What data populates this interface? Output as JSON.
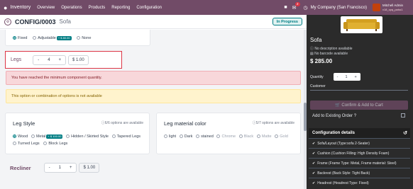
{
  "navbar": {
    "brand": "Inventory",
    "menu": [
      "Overview",
      "Operations",
      "Products",
      "Reporting",
      "Configuration"
    ],
    "notif_count": "2",
    "company": "My Company (San Francisco)",
    "user_name": "Mitchell Admin",
    "user_db": "v18_cpq_paho1"
  },
  "control": {
    "title": "CONFIG/0003",
    "subtitle": "Sofa",
    "status": "In Progress"
  },
  "top_card": {
    "options": [
      {
        "label": "Fixed",
        "selected": true
      },
      {
        "label": "Adjustable",
        "price": "+ $ 80.00"
      },
      {
        "label": "None"
      }
    ]
  },
  "legs": {
    "label": "Legs",
    "minus": "-",
    "value": "4",
    "plus": "+",
    "price": "$ 1.00"
  },
  "alerts": {
    "danger": "You have reached the minimum component quantity.",
    "warning": "This option or combination of options is not available"
  },
  "leg_style": {
    "title": "Leg Style",
    "meta": "6/6 options are available",
    "options": [
      {
        "label": "Wood",
        "selected": true
      },
      {
        "label": "Metal",
        "price": "+ $ 100.00"
      },
      {
        "label": "Hidden / Skirted Style"
      },
      {
        "label": "Tapered Legs"
      },
      {
        "label": "Turned Legs"
      },
      {
        "label": "Block Legs"
      }
    ]
  },
  "leg_color": {
    "title": "Leg material color",
    "meta": "5/7 options are available",
    "options": [
      {
        "label": "light",
        "muted": false
      },
      {
        "label": "Dark",
        "muted": false
      },
      {
        "label": "stained",
        "muted": false
      },
      {
        "label": "Chrome",
        "muted": true
      },
      {
        "label": "Black",
        "muted": true
      },
      {
        "label": "Matte",
        "muted": true
      },
      {
        "label": "Gold",
        "muted": true
      }
    ]
  },
  "recliner": {
    "label": "Recliner",
    "minus": "-",
    "value": "1",
    "plus": "+",
    "price": "$ 1.00"
  },
  "panel": {
    "product": "Sofa",
    "no_description": "No description available",
    "no_barcode": "No barcode available",
    "price": "$ 285.00",
    "qty_label": "Quantity",
    "qty_minus": "-",
    "qty_value": "1",
    "qty_plus": "+",
    "customer_label": "Customer",
    "confirm": "Confirm & Add to Cart",
    "existing": "Add to Existing Order ?",
    "details_title": "Configuration details",
    "details": [
      "Sofa/Layout (Type:sofa 2-Seater)",
      "Cushion (Cushion Filling: High Density Foam)",
      "Frame (Frame Type: Metal, Frame material: Steel)",
      "Backrest (Back Style: Tight Back)",
      "Headrest (Headrest Type: Fixed)"
    ]
  },
  "colors": {
    "primary": "#714b67",
    "teal": "#017e84",
    "danger": "#dc3545",
    "panel_bg": "#2b2b2b"
  }
}
